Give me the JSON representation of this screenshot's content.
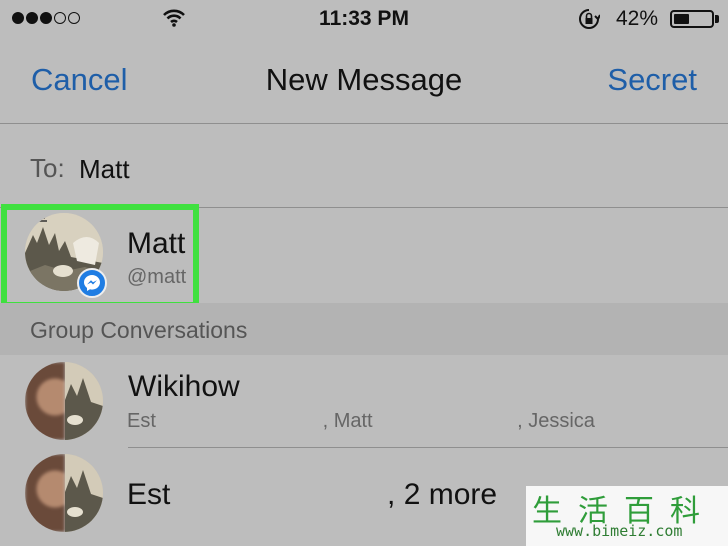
{
  "status_bar": {
    "signal_dots_filled": 3,
    "signal_dots_total": 5,
    "time": "11:33 PM",
    "battery_percent": "42%",
    "battery_level": 0.42,
    "icons": [
      "wifi-icon",
      "rotation-lock-icon",
      "battery-icon"
    ]
  },
  "nav": {
    "cancel_label": "Cancel",
    "title": "New Message",
    "secret_label": "Secret",
    "accent_color": "#1e5ea8"
  },
  "to_field": {
    "label": "To:",
    "value": "Matt"
  },
  "contact_result": {
    "name": "Matt",
    "handle": "@matt",
    "badge_icon": "messenger-icon",
    "highlight_color": "#3fe03f"
  },
  "group_section": {
    "title": "Group Conversations"
  },
  "conversations": [
    {
      "title": "Wikihow",
      "participants": "Est                              , Matt                          , Jessica"
    },
    {
      "line": "Est                          , 2 more"
    }
  ],
  "watermark": {
    "chars": "生活百科",
    "url": "www.bimeiz.com"
  }
}
